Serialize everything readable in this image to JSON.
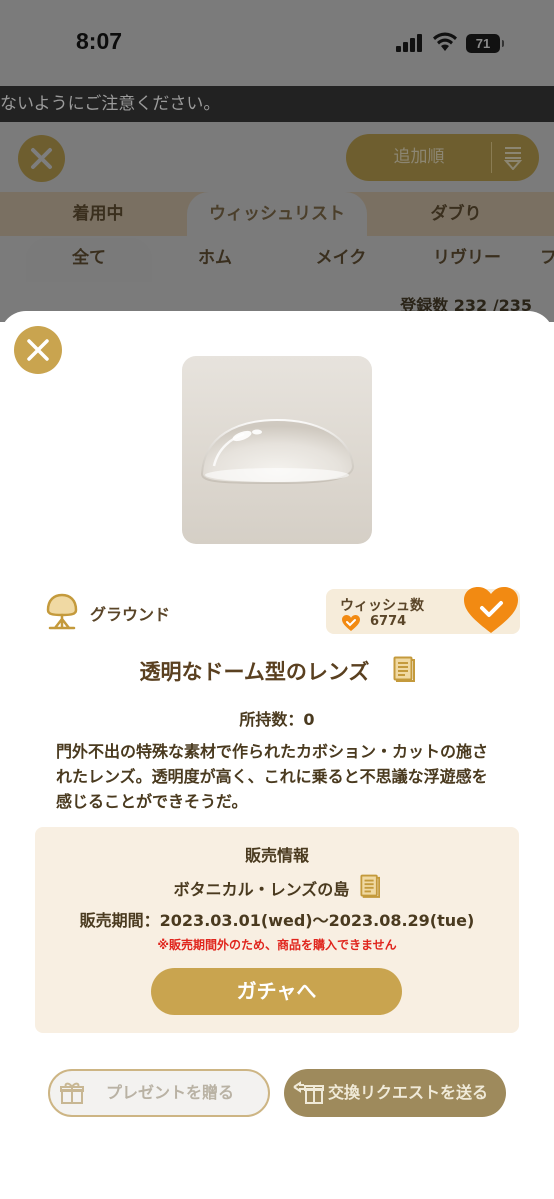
{
  "status_bar": {
    "time": "8:07",
    "battery": "71"
  },
  "notice": "ないようにご注意ください。",
  "sort": {
    "label": "追加順"
  },
  "tabs": [
    {
      "label": "着用中"
    },
    {
      "label": "ウィッシュリスト"
    },
    {
      "label": "ダブり"
    }
  ],
  "subtabs": [
    {
      "label": "全て"
    },
    {
      "label": "ホム"
    },
    {
      "label": "メイク"
    },
    {
      "label": "リヴリー"
    },
    {
      "label": "フ"
    }
  ],
  "registration": {
    "text": "登録数 232 /235"
  },
  "item": {
    "category": "グラウンド",
    "wish_label": "ウィッシュ数",
    "wish_count": "6774",
    "name": "透明なドーム型のレンズ",
    "owned": "所持数：0",
    "description": "門外不出の特殊な素材で作られたカボション・カットの施されたレンズ。透明度が高く、これに乗ると不思議な浮遊感を感じることができそうだ。"
  },
  "sales": {
    "title": "販売情報",
    "place": "ボタニカル・レンズの島",
    "period": "販売期間：2023.03.01(wed)〜2023.08.29(tue)",
    "warning": "※販売期間外のため、商品を購入できません",
    "gacha_button": "ガチャへ"
  },
  "actions": {
    "present": "プレゼントを贈る",
    "exchange": "交換リクエストを送る"
  },
  "colors": {
    "accent_gold": "#c9a44f",
    "wish_orange": "#f28a12",
    "warning_red": "#e0251d"
  }
}
